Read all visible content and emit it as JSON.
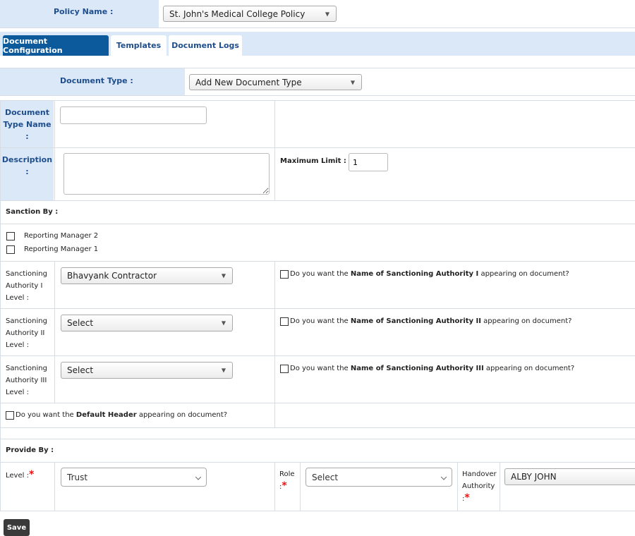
{
  "policy": {
    "label": "Policy Name :",
    "selected": "St. John's Medical College Policy"
  },
  "tabs": [
    {
      "label": "Document Configuration"
    },
    {
      "label": "Templates"
    },
    {
      "label": "Document Logs"
    }
  ],
  "doc_type": {
    "label": "Document Type :",
    "selected": "Add New Document Type"
  },
  "doc_type_name": {
    "label_line1": "Document",
    "label_line2": "Type Name",
    "label_line3": ":",
    "value": ""
  },
  "description": {
    "label_line1": "Description",
    "label_line2": ":",
    "value": ""
  },
  "max_limit": {
    "label": "Maximum Limit :",
    "value": "1"
  },
  "sanction": {
    "header": "Sanction By :",
    "checkboxes": [
      {
        "label": "Reporting Manager 2"
      },
      {
        "label": "Reporting Manager 1"
      }
    ],
    "levels": [
      {
        "l1": "Sanctioning",
        "l2": "Authority I",
        "l3": "Level :",
        "selected": "Bhavyank Contractor",
        "q_pre": "Do you want the ",
        "q_bold": "Name of Sanctioning Authority I",
        "q_post": " appearing on document?"
      },
      {
        "l1": "Sanctioning",
        "l2": "Authority II",
        "l3": "Level :",
        "selected": "Select",
        "q_pre": "Do you want the ",
        "q_bold": "Name of Sanctioning Authority II",
        "q_post": " appearing on document?"
      },
      {
        "l1": "Sanctioning",
        "l2": "Authority III",
        "l3": "Level :",
        "selected": "Select",
        "q_pre": "Do you want the ",
        "q_bold": "Name of Sanctioning Authority III",
        "q_post": " appearing on document?"
      }
    ],
    "default_header": {
      "pre": "Do you want the ",
      "bold": "Default Header",
      "post": " appearing on document?"
    }
  },
  "provide": {
    "header": "Provide By :",
    "level_label": "Level :",
    "level_selected": "Trust",
    "role_label": "Role",
    "role_colon": ":",
    "role_selected": "Select",
    "handover_l1": "Handover",
    "handover_l2": "Authority",
    "handover_l3": ":",
    "handover_selected": "ALBY JOHN",
    "required_mark": "*"
  },
  "save_label": "Save",
  "colors": {
    "tab_active": "#0c5a9c",
    "light_cell": "#dbe8f8",
    "required": "#ee1111"
  }
}
